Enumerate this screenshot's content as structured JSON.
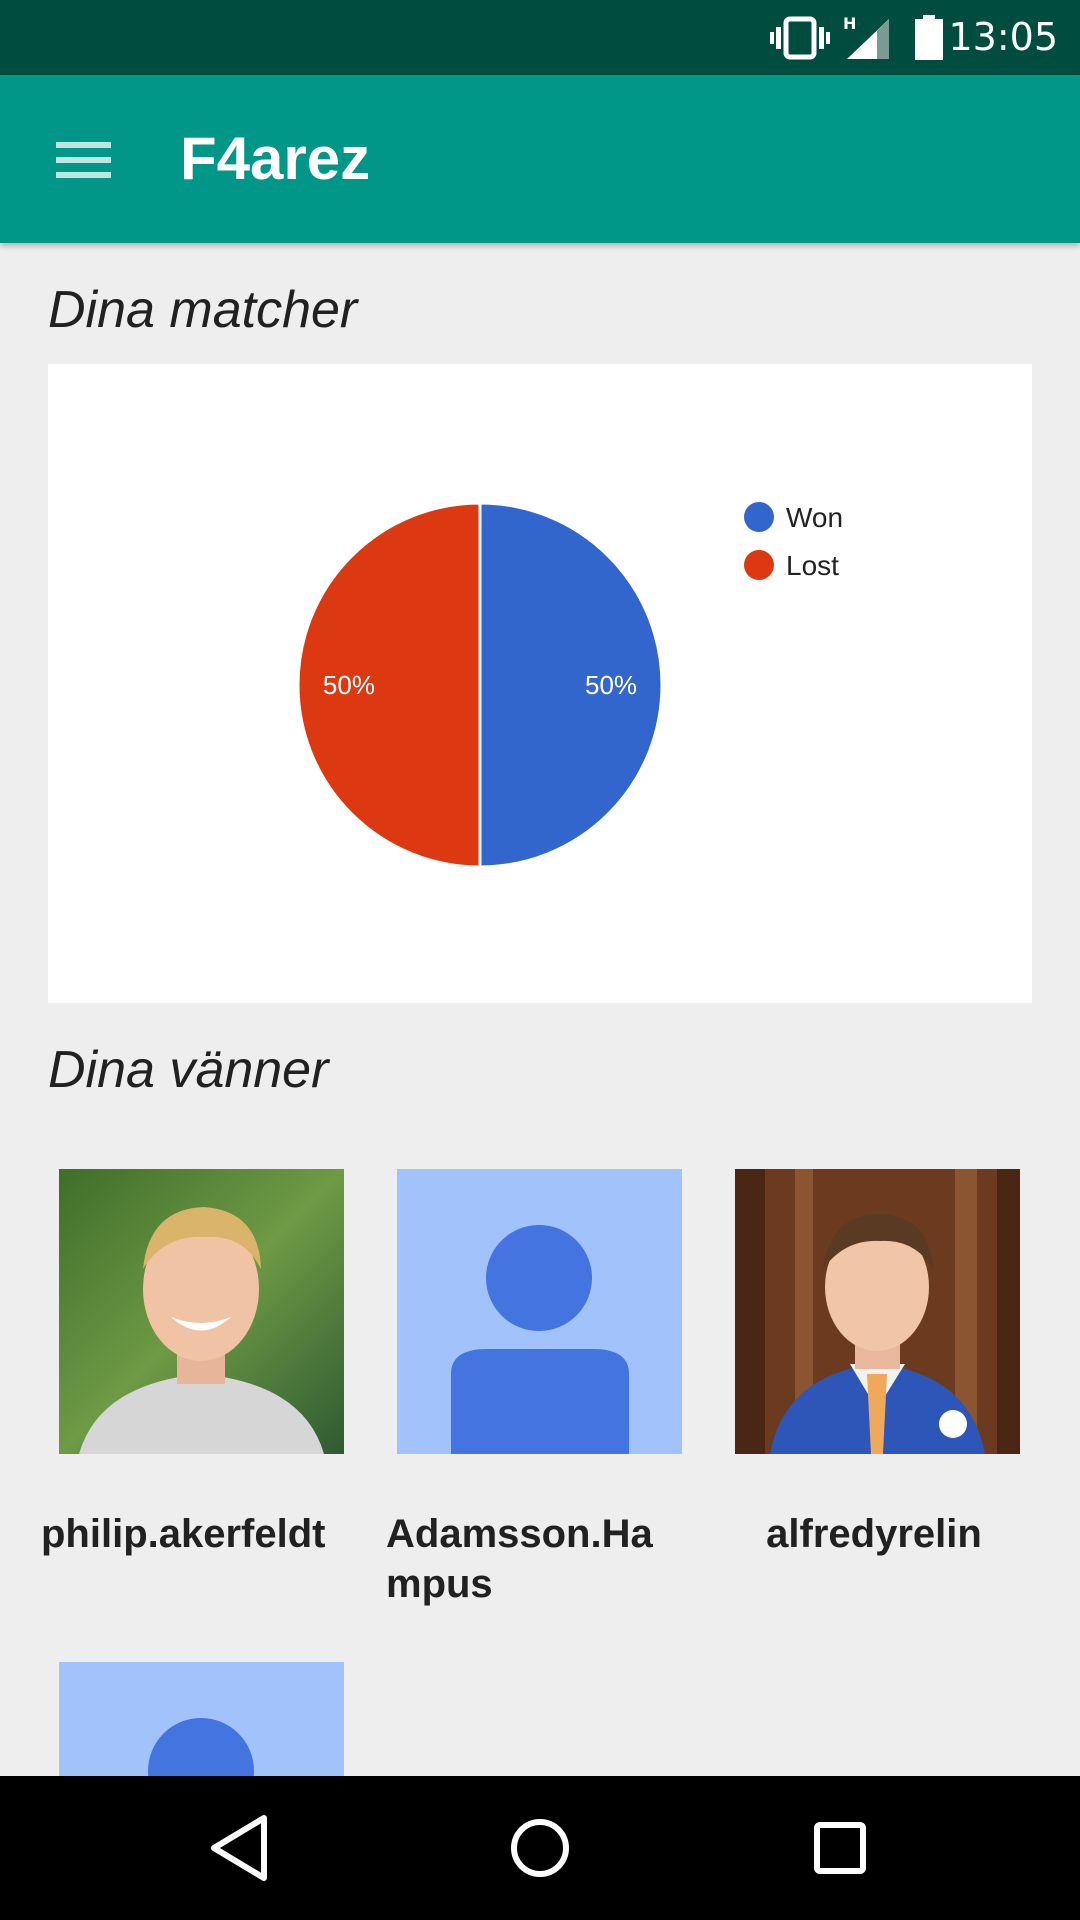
{
  "status_bar": {
    "time": "13:05",
    "icons": [
      "vibrate-icon",
      "network-h-icon",
      "signal-icon",
      "battery-icon"
    ]
  },
  "app_bar": {
    "title": "F4arez",
    "menu_icon": "menu-icon",
    "color": "#009688"
  },
  "matches_section": {
    "heading": "Dina matcher"
  },
  "chart_data": {
    "type": "pie",
    "slices": [
      {
        "label": "Won",
        "value": 50,
        "color": "#3366cc",
        "value_label": "50%"
      },
      {
        "label": "Lost",
        "value": 50,
        "color": "#dc3912",
        "value_label": "50%"
      }
    ],
    "legend_position": "right",
    "title": ""
  },
  "friends_section": {
    "heading": "Dina vänner",
    "friends": [
      {
        "name": "philip.akerfeldt",
        "avatar": "photo"
      },
      {
        "name": "Adamsson.Hampus",
        "avatar": "placeholder"
      },
      {
        "name": "alfredyrelin",
        "avatar": "photo"
      },
      {
        "name": "",
        "avatar": "placeholder"
      }
    ]
  },
  "nav_bar": {
    "buttons": [
      "back-icon",
      "home-icon",
      "recents-icon"
    ]
  }
}
